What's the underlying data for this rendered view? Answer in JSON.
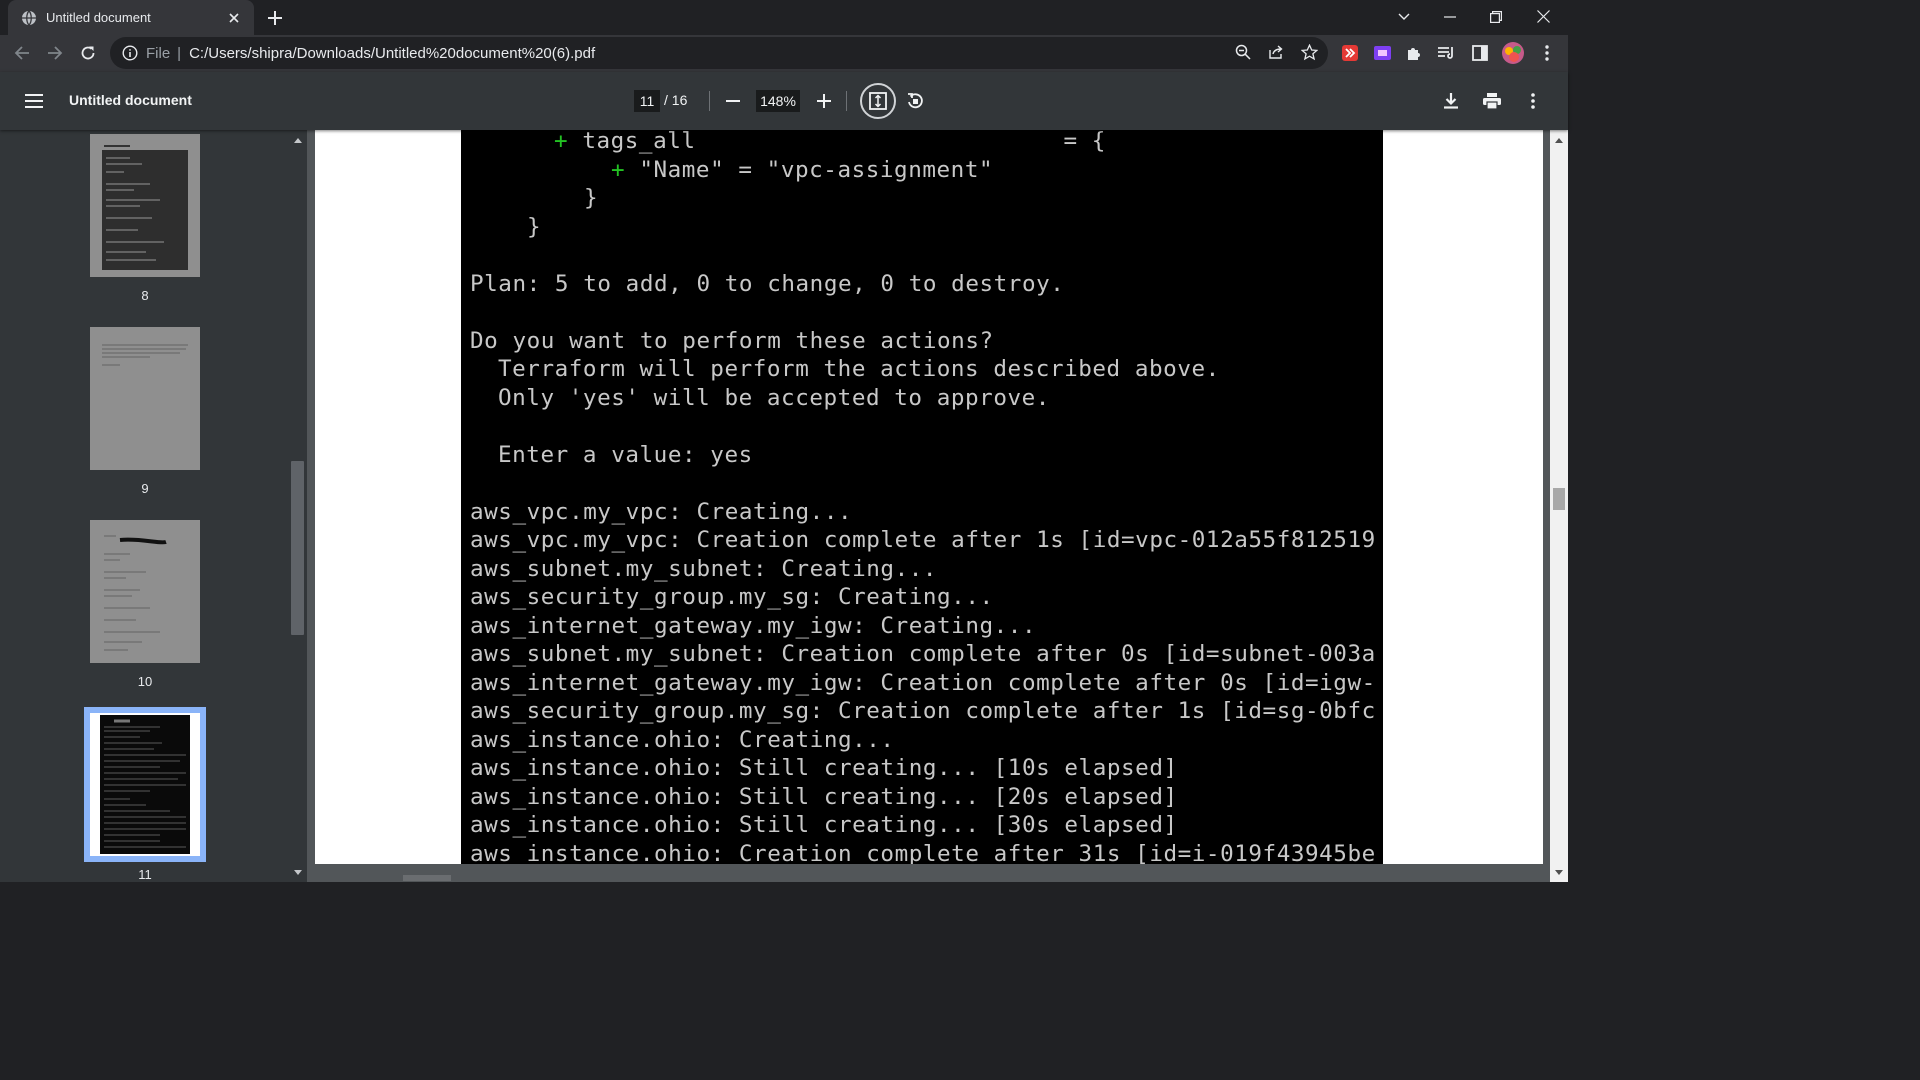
{
  "browser": {
    "tab": {
      "title": "Untitled document"
    },
    "address": {
      "scheme": "File",
      "url": "C:/Users/shipra/Downloads/Untitled%20document%20(6).pdf"
    }
  },
  "pdf_toolbar": {
    "title": "Untitled document",
    "current_page": "11",
    "total_pages": "/ 16",
    "zoom": "148%"
  },
  "thumbnails": [
    {
      "label": "8",
      "selected": false
    },
    {
      "label": "9",
      "selected": false
    },
    {
      "label": "10",
      "selected": false
    },
    {
      "label": "11",
      "selected": true
    }
  ],
  "terminal": {
    "lines": [
      {
        "prefix": "+ ",
        "text": "tags_all                          = {"
      },
      {
        "prefix": "+ ",
        "text": "\"Name\" = \"vpc-assignment\""
      },
      {
        "prefix": "",
        "text": "}"
      },
      {
        "prefix": "",
        "text": "}"
      },
      {
        "prefix": "",
        "text": "Plan: 5 to add, 0 to change, 0 to destroy."
      },
      {
        "prefix": "",
        "text": "Do you want to perform these actions?"
      },
      {
        "prefix": "",
        "text": "Terraform will perform the actions described above."
      },
      {
        "prefix": "",
        "text": "Only 'yes' will be accepted to approve."
      },
      {
        "prefix": "",
        "text": "Enter a value: yes"
      },
      {
        "prefix": "",
        "text": "aws_vpc.my_vpc: Creating..."
      },
      {
        "prefix": "",
        "text": "aws_vpc.my_vpc: Creation complete after 1s [id=vpc-012a55f812519"
      },
      {
        "prefix": "",
        "text": "aws_subnet.my_subnet: Creating..."
      },
      {
        "prefix": "",
        "text": "aws_security_group.my_sg: Creating..."
      },
      {
        "prefix": "",
        "text": "aws_internet_gateway.my_igw: Creating..."
      },
      {
        "prefix": "",
        "text": "aws_subnet.my_subnet: Creation complete after 0s [id=subnet-003a"
      },
      {
        "prefix": "",
        "text": "aws_internet_gateway.my_igw: Creation complete after 0s [id=igw-"
      },
      {
        "prefix": "",
        "text": "aws_security_group.my_sg: Creation complete after 1s [id=sg-0bfc"
      },
      {
        "prefix": "",
        "text": "aws_instance.ohio: Creating..."
      },
      {
        "prefix": "",
        "text": "aws_instance.ohio: Still creating... [10s elapsed]"
      },
      {
        "prefix": "",
        "text": "aws_instance.ohio: Still creating... [20s elapsed]"
      },
      {
        "prefix": "",
        "text": "aws_instance.ohio: Still creating... [30s elapsed]"
      },
      {
        "prefix": "",
        "text": "aws_instance.ohio: Creation complete after 31s [id=i-019f43945be"
      }
    ]
  },
  "colors": {
    "terminal_bg": "#000000",
    "terminal_text": "#c8c8c8",
    "plus_green": "#23c223",
    "accent_selected": "#8ab4f8"
  }
}
